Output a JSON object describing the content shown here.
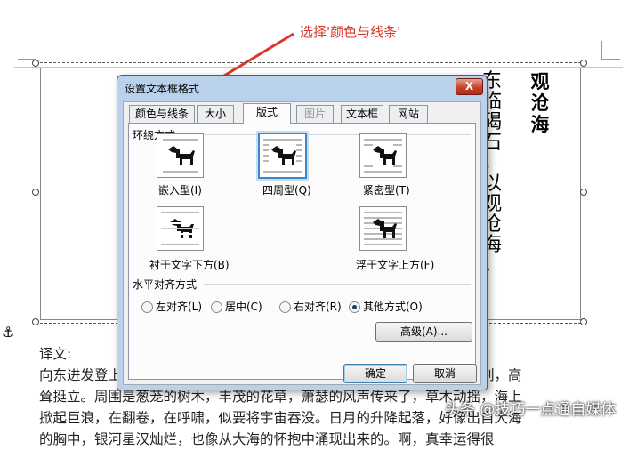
{
  "annotation": {
    "text": "选择'颜色与线条'",
    "color": "#d9382b"
  },
  "document": {
    "poem_title": "观沧海",
    "poem_columns": [
      "东临碣石，以观沧海。"
    ],
    "translation_heading": "译文:",
    "translation_lines": [
      "向东进发登上碣石山，得以观赏大海的奇景。海水多么宽阔浩荡，山岛罗列，高",
      "耸挺立。周围是葱茏的树木，丰茂的花草，萧瑟的风声传来了，草木动摇，海上",
      "掀起巨浪，在翻卷，在呼啸，似要将宇宙吞没。日月的升降起落，好像出自大海",
      "的胸中，银河星汉灿烂，也像从大海的怀抱中涌现出来的。啊，真幸运得很"
    ],
    "watermark": "头条 @技巧一点通自媒体"
  },
  "dialog": {
    "title": "设置文本框格式",
    "close_symbol": "X",
    "tabs": [
      {
        "label": "颜色与线条",
        "active": false,
        "disabled": false
      },
      {
        "label": "大小",
        "active": false,
        "disabled": false
      },
      {
        "label": "版式",
        "active": true,
        "disabled": false
      },
      {
        "label": "图片",
        "active": false,
        "disabled": true
      },
      {
        "label": "文本框",
        "active": false,
        "disabled": false
      },
      {
        "label": "网站",
        "active": false,
        "disabled": false
      }
    ],
    "wrap_group_label": "环绕方式",
    "wrap_styles": [
      {
        "label": "嵌入型(I)",
        "selected": false
      },
      {
        "label": "四周型(Q)",
        "selected": true
      },
      {
        "label": "紧密型(T)",
        "selected": false
      },
      {
        "label": "衬于文字下方(B)",
        "selected": false
      },
      {
        "label": "浮于文字上方(F)",
        "selected": false
      }
    ],
    "align_group_label": "水平对齐方式",
    "align_options": [
      {
        "label": "左对齐(L)",
        "checked": false
      },
      {
        "label": "居中(C)",
        "checked": false
      },
      {
        "label": "右对齐(R)",
        "checked": false
      },
      {
        "label": "其他方式(O)",
        "checked": true
      }
    ],
    "advanced_button": "高级(A)...",
    "ok_button": "确定",
    "cancel_button": "取消"
  }
}
